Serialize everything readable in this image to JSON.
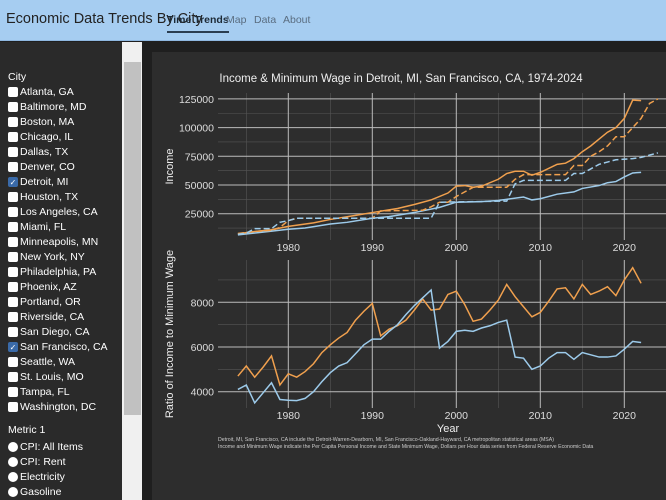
{
  "header": {
    "title": "Economic Data Trends By City",
    "tabs": [
      {
        "label": "Time Trends",
        "active": true
      },
      {
        "label": "Map"
      },
      {
        "label": "Data"
      },
      {
        "label": "About"
      }
    ]
  },
  "sidebar": {
    "city_label": "City",
    "cities": [
      {
        "label": "Atlanta, GA",
        "checked": false
      },
      {
        "label": "Baltimore, MD",
        "checked": false
      },
      {
        "label": "Boston, MA",
        "checked": false
      },
      {
        "label": "Chicago, IL",
        "checked": false
      },
      {
        "label": "Dallas, TX",
        "checked": false
      },
      {
        "label": "Denver, CO",
        "checked": false
      },
      {
        "label": "Detroit, MI",
        "checked": true
      },
      {
        "label": "Houston, TX",
        "checked": false
      },
      {
        "label": "Los Angeles, CA",
        "checked": false
      },
      {
        "label": "Miami, FL",
        "checked": false
      },
      {
        "label": "Minneapolis, MN",
        "checked": false
      },
      {
        "label": "New York, NY",
        "checked": false
      },
      {
        "label": "Philadelphia, PA",
        "checked": false
      },
      {
        "label": "Phoenix, AZ",
        "checked": false
      },
      {
        "label": "Portland, OR",
        "checked": false
      },
      {
        "label": "Riverside, CA",
        "checked": false
      },
      {
        "label": "San Diego, CA",
        "checked": false
      },
      {
        "label": "San Francisco, CA",
        "checked": true
      },
      {
        "label": "Seattle, WA",
        "checked": false
      },
      {
        "label": "St. Louis, MO",
        "checked": false
      },
      {
        "label": "Tampa, FL",
        "checked": false
      },
      {
        "label": "Washington, DC",
        "checked": false
      }
    ],
    "metric_label": "Metric 1",
    "metrics": [
      "CPI: All Items",
      "CPI: Rent",
      "Electricity",
      "Gasoline"
    ]
  },
  "colors": {
    "detroit": "#9dcbeb",
    "san_francisco": "#f0a04e"
  },
  "chart_data": [
    {
      "type": "line",
      "title": "Income & Minimum Wage in Detroit, MI, San Francisco, CA, 1974-2024",
      "ylabel": "Income",
      "xlabel": "",
      "xlim": [
        1972,
        2025
      ],
      "ylim": [
        2000,
        132000
      ],
      "xticks": [
        1980,
        1990,
        2000,
        2010,
        2020
      ],
      "yticks": [
        25000,
        50000,
        75000,
        100000,
        125000
      ],
      "grid": true,
      "series": [
        {
          "city": "san_francisco",
          "style": "solid",
          "points": [
            [
              1974,
              7500
            ],
            [
              1976,
              9500
            ],
            [
              1978,
              11000
            ],
            [
              1980,
              14000
            ],
            [
              1983,
              17000
            ],
            [
              1985,
              20000
            ],
            [
              1988,
              23500
            ],
            [
              1990,
              26000
            ],
            [
              1993,
              29500
            ],
            [
              1995,
              33000
            ],
            [
              1997,
              37000
            ],
            [
              1999,
              43000
            ],
            [
              2000,
              49000
            ],
            [
              2001,
              49500
            ],
            [
              2002,
              48000
            ],
            [
              2003,
              49000
            ],
            [
              2005,
              55000
            ],
            [
              2006,
              60000
            ],
            [
              2007,
              62000
            ],
            [
              2008,
              62000
            ],
            [
              2009,
              58500
            ],
            [
              2010,
              61000
            ],
            [
              2012,
              68000
            ],
            [
              2013,
              69000
            ],
            [
              2014,
              73000
            ],
            [
              2015,
              79000
            ],
            [
              2016,
              84000
            ],
            [
              2017,
              90000
            ],
            [
              2018,
              96000
            ],
            [
              2019,
              100000
            ],
            [
              2020,
              108000
            ],
            [
              2021,
              124000
            ],
            [
              2022,
              123500
            ]
          ]
        },
        {
          "city": "detroit",
          "style": "solid",
          "points": [
            [
              1974,
              6500
            ],
            [
              1977,
              9000
            ],
            [
              1980,
              11500
            ],
            [
              1982,
              12500
            ],
            [
              1985,
              16000
            ],
            [
              1987,
              17500
            ],
            [
              1990,
              21000
            ],
            [
              1992,
              22500
            ],
            [
              1995,
              26000
            ],
            [
              1998,
              30500
            ],
            [
              2000,
              35000
            ],
            [
              2003,
              35500
            ],
            [
              2005,
              36500
            ],
            [
              2008,
              39500
            ],
            [
              2009,
              37000
            ],
            [
              2010,
              38000
            ],
            [
              2012,
              42000
            ],
            [
              2014,
              44000
            ],
            [
              2015,
              47000
            ],
            [
              2017,
              49500
            ],
            [
              2018,
              52000
            ],
            [
              2019,
              53000
            ],
            [
              2020,
              57000
            ],
            [
              2021,
              60500
            ],
            [
              2022,
              61000
            ]
          ]
        },
        {
          "city": "san_francisco",
          "style": "dashed",
          "points": [
            [
              1974,
              7800
            ],
            [
              1976,
              9500
            ],
            [
              1978,
              10500
            ],
            [
              1979,
              13000
            ],
            [
              1980,
              19000
            ],
            [
              1981,
              21000
            ],
            [
              1989,
              21000
            ],
            [
              1990,
              21000
            ],
            [
              1991,
              27500
            ],
            [
              1996,
              28000
            ],
            [
              1997,
              31000
            ],
            [
              1998,
              35000
            ],
            [
              1999,
              35000
            ],
            [
              2000,
              40000
            ],
            [
              2002,
              48000
            ],
            [
              2006,
              48000
            ],
            [
              2007,
              55000
            ],
            [
              2008,
              59000
            ],
            [
              2013,
              59000
            ],
            [
              2014,
              67000
            ],
            [
              2015,
              67000
            ],
            [
              2016,
              75000
            ],
            [
              2017,
              79000
            ],
            [
              2018,
              84000
            ],
            [
              2019,
              92000
            ],
            [
              2020,
              92000
            ],
            [
              2021,
              100000
            ],
            [
              2022,
              108000
            ],
            [
              2023,
              121000
            ],
            [
              2024,
              125000
            ]
          ]
        },
        {
          "city": "detroit",
          "style": "dashed",
          "points": [
            [
              1974,
              7000
            ],
            [
              1975,
              8000
            ],
            [
              1976,
              12000
            ],
            [
              1978,
              12000
            ],
            [
              1979,
              17500
            ],
            [
              1980,
              19000
            ],
            [
              1981,
              21000
            ],
            [
              1997,
              21000
            ],
            [
              1998,
              35000
            ],
            [
              2006,
              36000
            ],
            [
              2007,
              51000
            ],
            [
              2008,
              54000
            ],
            [
              2013,
              54000
            ],
            [
              2014,
              60000
            ],
            [
              2015,
              60000
            ],
            [
              2016,
              64000
            ],
            [
              2017,
              68000
            ],
            [
              2018,
              70000
            ],
            [
              2019,
              72000
            ],
            [
              2021,
              73000
            ],
            [
              2022,
              74000
            ],
            [
              2023,
              76000
            ],
            [
              2024,
              78000
            ]
          ]
        }
      ]
    },
    {
      "type": "line",
      "title": "",
      "ylabel": "Ratio of Income to Minimum Wage",
      "xlabel": "Year",
      "xlim": [
        1972,
        2025
      ],
      "ylim": [
        3270,
        9360
      ],
      "xticks": [
        1980,
        1990,
        2000,
        2010,
        2020
      ],
      "yticks": [
        4000,
        6000,
        8000
      ],
      "grid": true,
      "x": [
        1974,
        1975,
        1976,
        1977,
        1978,
        1979,
        1980,
        1981,
        1982,
        1983,
        1984,
        1985,
        1986,
        1987,
        1988,
        1989,
        1990,
        1991,
        1992,
        1993,
        1994,
        1995,
        1996,
        1997,
        1998,
        1999,
        2000,
        2001,
        2002,
        2003,
        2004,
        2005,
        2006,
        2007,
        2008,
        2009,
        2010,
        2011,
        2012,
        2013,
        2014,
        2015,
        2016,
        2017,
        2018,
        2019,
        2020,
        2021,
        2022
      ],
      "series": [
        {
          "city": "san_francisco",
          "values": [
            4700,
            5150,
            4650,
            5100,
            5600,
            4300,
            4800,
            4650,
            4900,
            5250,
            5750,
            6100,
            6400,
            6650,
            7200,
            7600,
            7950,
            6500,
            6800,
            6950,
            7200,
            7650,
            8150,
            7650,
            7700,
            8350,
            8500,
            7900,
            7150,
            7250,
            7650,
            8100,
            8800,
            8250,
            7800,
            7350,
            7550,
            8050,
            8600,
            8650,
            8150,
            8800,
            8350,
            8500,
            8700,
            8300,
            9000,
            9550,
            8850
          ]
        },
        {
          "city": "detroit",
          "values": [
            4100,
            4300,
            3500,
            3950,
            4400,
            3650,
            3620,
            3600,
            3700,
            4000,
            4450,
            4850,
            5150,
            5300,
            5700,
            6100,
            6350,
            6350,
            6700,
            7000,
            7450,
            7850,
            8200,
            8550,
            5950,
            6250,
            6700,
            6750,
            6700,
            6850,
            6950,
            7100,
            7200,
            5550,
            5500,
            5000,
            5150,
            5500,
            5750,
            5750,
            5450,
            5750,
            5650,
            5550,
            5550,
            5600,
            5900,
            6250,
            6200
          ]
        }
      ]
    }
  ],
  "footnote": [
    "Detroit, MI, San Francisco, CA include the Detroit-Warren-Dearborn, MI, San Francisco-Oakland-Hayward, CA metropolitan statistical areas (MSA)",
    "Income and Minimum Wage indicate the Per Capita Personal Income and State Minimum Wage, Dollars per Hour data series from Federal Reserve Economic Data"
  ]
}
